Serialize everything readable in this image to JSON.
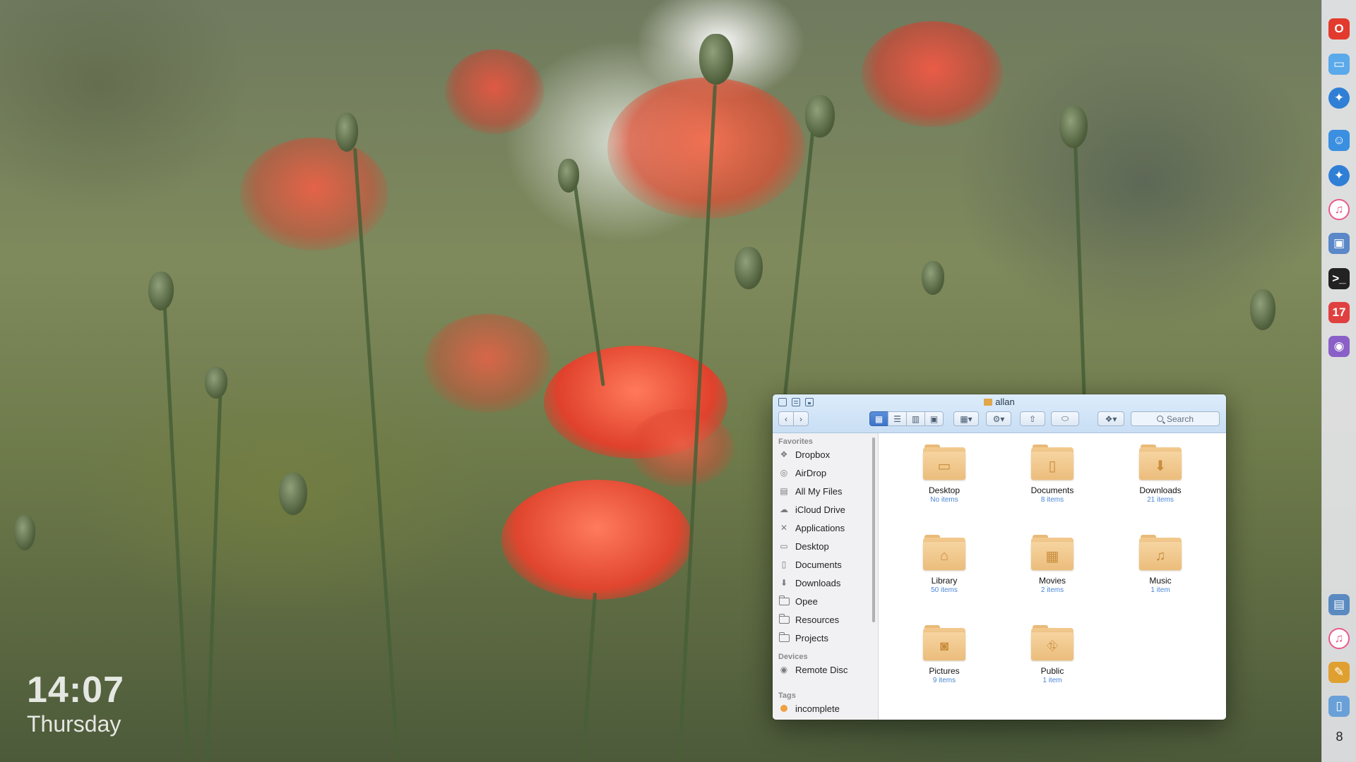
{
  "desktop": {
    "clock_time": "14:07",
    "clock_day": "Thursday"
  },
  "dock": {
    "items": [
      {
        "name": "Opera",
        "icon": "opera-icon",
        "color": "#e23b2e",
        "glyph": "O"
      },
      {
        "name": "Folder",
        "icon": "folder-icon",
        "color": "#5aa9ea",
        "glyph": "▭"
      },
      {
        "name": "Safari",
        "icon": "compass-icon",
        "color": "#2f7fd6",
        "glyph": "✦"
      },
      {
        "name": "Finder",
        "icon": "finder-icon",
        "color": "#3a8fe0",
        "glyph": "☺"
      },
      {
        "name": "Safari",
        "icon": "compass-icon",
        "color": "#2f7fd6",
        "glyph": "✦"
      },
      {
        "name": "iTunes",
        "icon": "music-note-icon",
        "color": "#e85a8a",
        "glyph": "♫"
      },
      {
        "name": "Preview",
        "icon": "preview-icon",
        "color": "#5a88c8",
        "glyph": "▣"
      },
      {
        "name": "Terminal",
        "icon": "terminal-icon",
        "color": "#222222",
        "glyph": ">_"
      },
      {
        "name": "Calendar",
        "icon": "calendar-icon",
        "color": "#e04040",
        "glyph": "17"
      },
      {
        "name": "Automator",
        "icon": "robot-icon",
        "color": "#8a60c8",
        "glyph": "◉"
      },
      {
        "name": "Photos",
        "icon": "photo-browser-icon",
        "color": "#5a8ac0",
        "glyph": "▤"
      },
      {
        "name": "iTunes",
        "icon": "music-note-icon",
        "color": "#e85a8a",
        "glyph": "♫"
      },
      {
        "name": "Image Capture",
        "icon": "image-icon",
        "color": "#e0a030",
        "glyph": "✎"
      },
      {
        "name": "Trash",
        "icon": "trash-icon",
        "color": "#6aa0d8",
        "glyph": "▯"
      }
    ],
    "badge": "8"
  },
  "finder": {
    "title": "allan",
    "search_placeholder": "Search",
    "sidebar": {
      "favorites_header": "Favorites",
      "favorites": [
        {
          "label": "Dropbox",
          "icon": "dropbox-icon",
          "glyph": "❖"
        },
        {
          "label": "AirDrop",
          "icon": "airdrop-icon",
          "glyph": "◎"
        },
        {
          "label": "All My Files",
          "icon": "all-files-icon",
          "glyph": "▤"
        },
        {
          "label": "iCloud Drive",
          "icon": "cloud-icon",
          "glyph": "☁"
        },
        {
          "label": "Applications",
          "icon": "applications-icon",
          "glyph": "✕"
        },
        {
          "label": "Desktop",
          "icon": "desktop-icon",
          "glyph": "▭"
        },
        {
          "label": "Documents",
          "icon": "document-icon",
          "glyph": "▯"
        },
        {
          "label": "Downloads",
          "icon": "download-icon",
          "glyph": "⬇"
        },
        {
          "label": "Opee",
          "icon": "folder-icon",
          "glyph": ""
        },
        {
          "label": "Resources",
          "icon": "folder-icon",
          "glyph": ""
        },
        {
          "label": "Projects",
          "icon": "folder-icon",
          "glyph": ""
        }
      ],
      "devices_header": "Devices",
      "devices": [
        {
          "label": "Remote Disc",
          "icon": "disc-icon",
          "glyph": "◉"
        }
      ],
      "tags_header": "Tags",
      "tags": [
        {
          "label": "incomplete",
          "color": "#f0a040"
        }
      ]
    },
    "folders": [
      {
        "name": "Desktop",
        "count": "No items",
        "icon": "desktop-folder-icon",
        "glyph": "▭"
      },
      {
        "name": "Documents",
        "count": "8 items",
        "icon": "documents-folder-icon",
        "glyph": "▯"
      },
      {
        "name": "Downloads",
        "count": "21 items",
        "icon": "downloads-folder-icon",
        "glyph": "⬇"
      },
      {
        "name": "Library",
        "count": "50 items",
        "icon": "library-folder-icon",
        "glyph": "⌂"
      },
      {
        "name": "Movies",
        "count": "2 items",
        "icon": "movies-folder-icon",
        "glyph": "▦"
      },
      {
        "name": "Music",
        "count": "1 item",
        "icon": "music-folder-icon",
        "glyph": "♫"
      },
      {
        "name": "Pictures",
        "count": "9 items",
        "icon": "pictures-folder-icon",
        "glyph": "◙"
      },
      {
        "name": "Public",
        "count": "1 item",
        "icon": "public-folder-icon",
        "glyph": "⛗"
      }
    ]
  }
}
